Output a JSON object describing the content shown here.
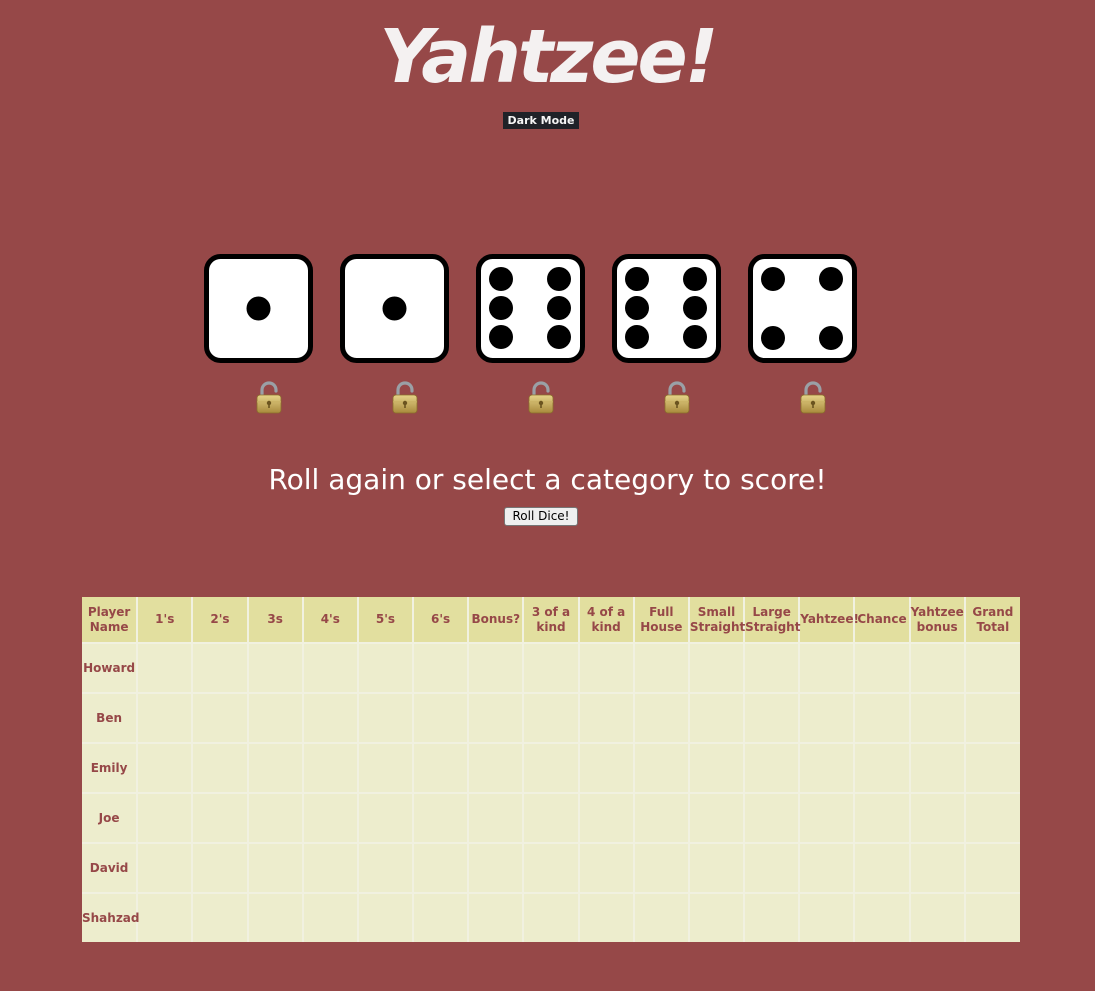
{
  "app": {
    "title": "Yahtzee!",
    "dark_mode_label": "Dark Mode"
  },
  "dice": [
    {
      "value": 1,
      "locked": false
    },
    {
      "value": 1,
      "locked": false
    },
    {
      "value": 6,
      "locked": false
    },
    {
      "value": 6,
      "locked": false
    },
    {
      "value": 4,
      "locked": false
    }
  ],
  "lock_icon": "padlock-icon",
  "message": "Roll again or select a category to score!",
  "roll_button_label": "Roll Dice!",
  "scorecard": {
    "headers": [
      "Player Name",
      "1's",
      "2's",
      "3s",
      "4's",
      "5's",
      "6's",
      "Bonus?",
      "3 of a kind",
      "4 of a kind",
      "Full House",
      "Small Straight",
      "Large Straight",
      "Yahtzee!",
      "Chance",
      "Yahtzee bonus",
      "Grand Total"
    ],
    "players": [
      "Howard",
      "Ben",
      "Emily",
      "Joe",
      "David",
      "Shahzad"
    ]
  },
  "colors": {
    "background": "#964848",
    "header_bg": "#e2df9f",
    "cell_bg": "#ededcd",
    "table_text": "#964848"
  }
}
